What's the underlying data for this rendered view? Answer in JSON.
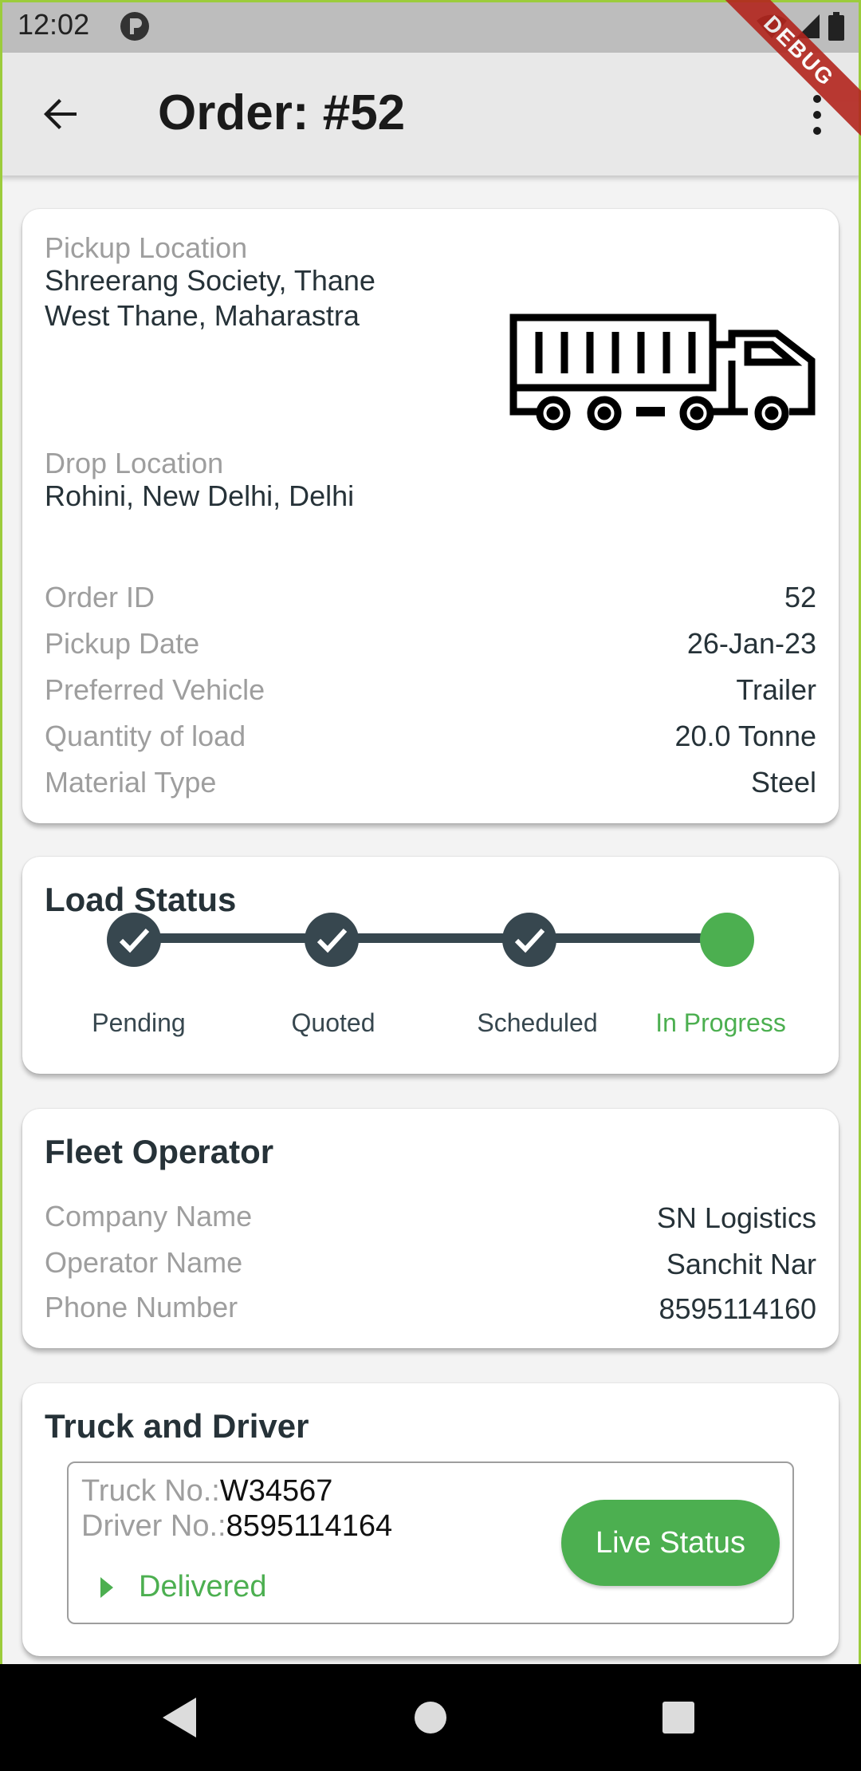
{
  "status_bar": {
    "time": "12:02",
    "icons": [
      "p-app-icon",
      "wifi-icon",
      "signal-icon",
      "battery-icon"
    ]
  },
  "debug_banner": "DEBUG",
  "app_bar": {
    "title": "Order: #52",
    "back_icon": "arrow-back-icon",
    "menu_icon": "more-vert-icon"
  },
  "order_card": {
    "pickup_label": "Pickup Location",
    "pickup_line1": "Shreerang Society, Thane",
    "pickup_line2": "West Thane, Maharastra",
    "drop_label": "Drop Location",
    "drop_value": "Rohini, New Delhi, Delhi",
    "image_icon": "truck-trailer-icon",
    "details": [
      {
        "label": "Order ID",
        "value": "52"
      },
      {
        "label": "Pickup Date",
        "value": "26-Jan-23"
      },
      {
        "label": "Preferred Vehicle",
        "value": "Trailer"
      },
      {
        "label": "Quantity of load",
        "value": "20.0 Tonne"
      },
      {
        "label": "Material Type",
        "value": "Steel"
      }
    ]
  },
  "load_status": {
    "title": "Load Status",
    "steps": [
      {
        "label": "Pending",
        "state": "done"
      },
      {
        "label": "Quoted",
        "state": "done"
      },
      {
        "label": "Scheduled",
        "state": "done"
      },
      {
        "label": "In Progress",
        "state": "active"
      }
    ],
    "colors": {
      "done": "#37474f",
      "active": "#4caf50"
    }
  },
  "fleet_operator": {
    "title": "Fleet Operator",
    "rows": [
      {
        "label": "Company Name",
        "value": "SN Logistics"
      },
      {
        "label": "Operator Name",
        "value": "Sanchit Nar"
      },
      {
        "label": "Phone Number",
        "value": "8595114160"
      }
    ]
  },
  "truck_driver": {
    "title": "Truck and Driver",
    "truck_label": "Truck No.:",
    "truck_value": "W34567",
    "driver_label": "Driver No.:",
    "driver_value": "8595114164",
    "status": "Delivered",
    "live_button": "Live Status",
    "accent": "#4caf50"
  },
  "nav_bar": {
    "icons": [
      "nav-back-icon",
      "nav-home-icon",
      "nav-recents-icon"
    ]
  }
}
